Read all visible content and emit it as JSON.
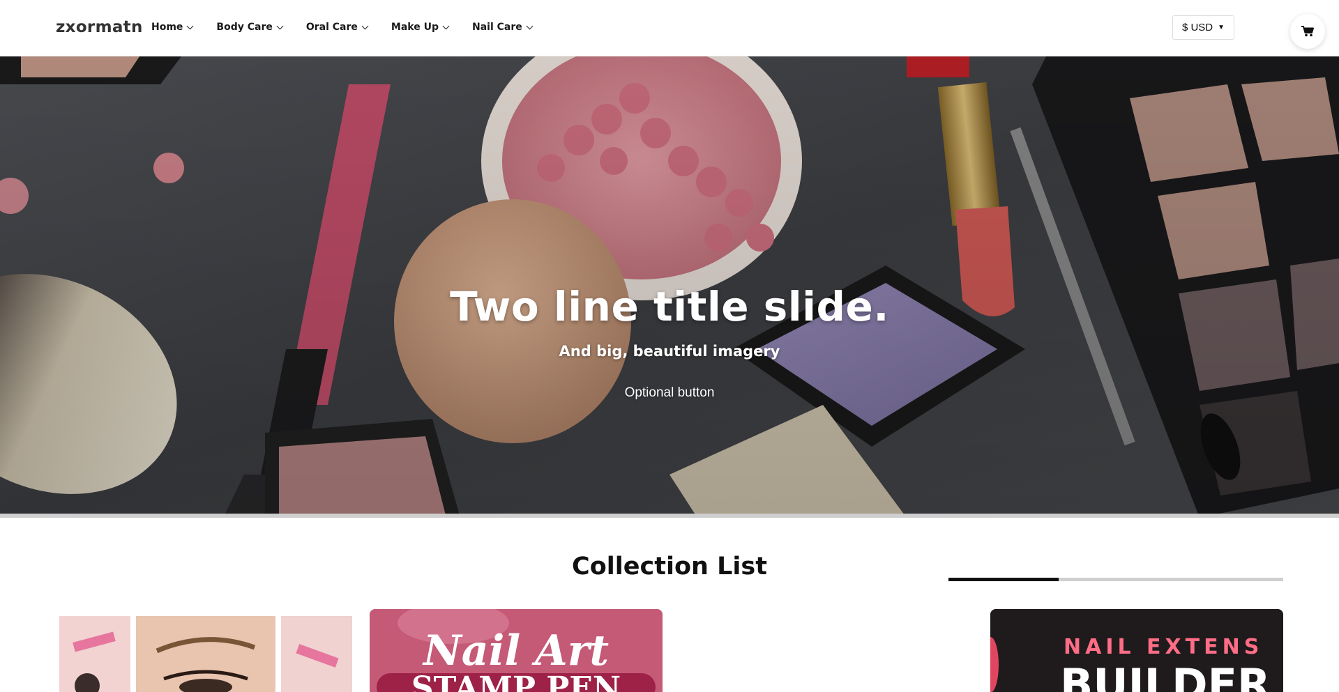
{
  "header": {
    "logo": "zxormatn",
    "nav": [
      {
        "label": "Home"
      },
      {
        "label": "Body Care"
      },
      {
        "label": "Oral Care"
      },
      {
        "label": "Make Up"
      },
      {
        "label": "Nail Care"
      }
    ],
    "currency": "$ USD",
    "icons": {
      "cart": "cart-icon",
      "dropdown": "chevron-down-icon"
    }
  },
  "hero": {
    "title": "Two line title slide.",
    "subtitle": "And big, beautiful imagery",
    "button_label": "Optional button"
  },
  "collection": {
    "title": "Collection List",
    "scroll_progress": 0.33,
    "cards": [
      {
        "image_text": ""
      },
      {
        "image_text_1": "Nail Art",
        "image_text_2": "STAMP PEN"
      },
      {
        "image_text_1": "NAIL EXTENS",
        "image_text_2": "BUILDER G"
      }
    ]
  },
  "colors": {
    "accent": "#111111",
    "hero_bg": "#45474b",
    "card_pink": "#c8607a",
    "card_dark": "#1f1b1d"
  }
}
